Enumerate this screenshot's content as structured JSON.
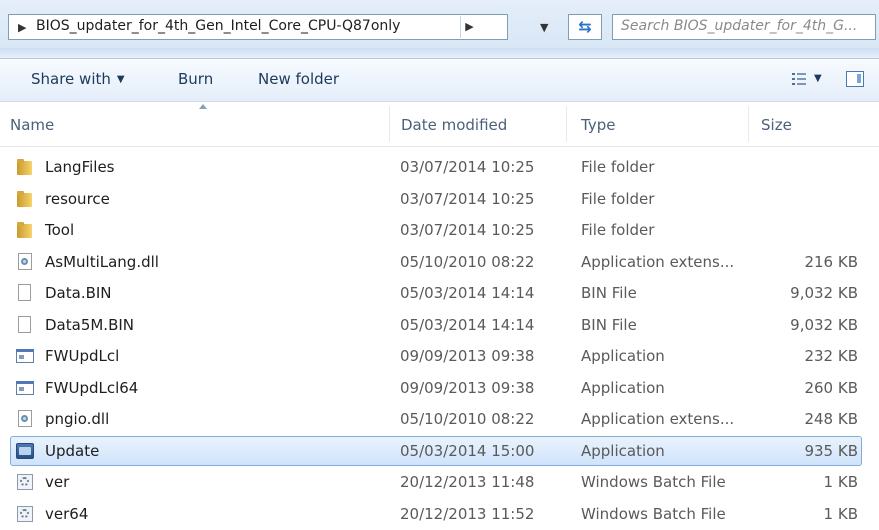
{
  "address": {
    "path": "BIOS_updater_for_4th_Gen_Intel_Core_CPU-Q87only",
    "search_placeholder": "Search BIOS_updater_for_4th_G..."
  },
  "toolbar": {
    "share_label": "Share with",
    "burn_label": "Burn",
    "new_folder_label": "New folder"
  },
  "columns": {
    "name": "Name",
    "date": "Date modified",
    "type": "Type",
    "size": "Size"
  },
  "files": [
    {
      "name": "LangFiles",
      "date": "03/07/2014 10:25",
      "type": "File folder",
      "size": "",
      "icon": "folder-icon"
    },
    {
      "name": "resource",
      "date": "03/07/2014 10:25",
      "type": "File folder",
      "size": "",
      "icon": "folder-icon"
    },
    {
      "name": "Tool",
      "date": "03/07/2014 10:25",
      "type": "File folder",
      "size": "",
      "icon": "folder-icon"
    },
    {
      "name": "AsMultiLang.dll",
      "date": "05/10/2010 08:22",
      "type": "Application extens...",
      "size": "216 KB",
      "icon": "dll-icon"
    },
    {
      "name": "Data.BIN",
      "date": "05/03/2014 14:14",
      "type": "BIN File",
      "size": "9,032 KB",
      "icon": "file-icon"
    },
    {
      "name": "Data5M.BIN",
      "date": "05/03/2014 14:14",
      "type": "BIN File",
      "size": "9,032 KB",
      "icon": "file-icon"
    },
    {
      "name": "FWUpdLcl",
      "date": "09/09/2013 09:38",
      "type": "Application",
      "size": "232 KB",
      "icon": "application-icon"
    },
    {
      "name": "FWUpdLcl64",
      "date": "09/09/2013 09:38",
      "type": "Application",
      "size": "260 KB",
      "icon": "application-icon"
    },
    {
      "name": "pngio.dll",
      "date": "05/10/2010 08:22",
      "type": "Application extens...",
      "size": "248 KB",
      "icon": "dll-icon"
    },
    {
      "name": "Update",
      "date": "05/03/2014 15:00",
      "type": "Application",
      "size": "935 KB",
      "icon": "update-app-icon",
      "selected": true
    },
    {
      "name": "ver",
      "date": "20/12/2013 11:48",
      "type": "Windows Batch File",
      "size": "1 KB",
      "icon": "batch-file-icon"
    },
    {
      "name": "ver64",
      "date": "20/12/2013 11:52",
      "type": "Windows Batch File",
      "size": "1 KB",
      "icon": "batch-file-icon"
    }
  ]
}
